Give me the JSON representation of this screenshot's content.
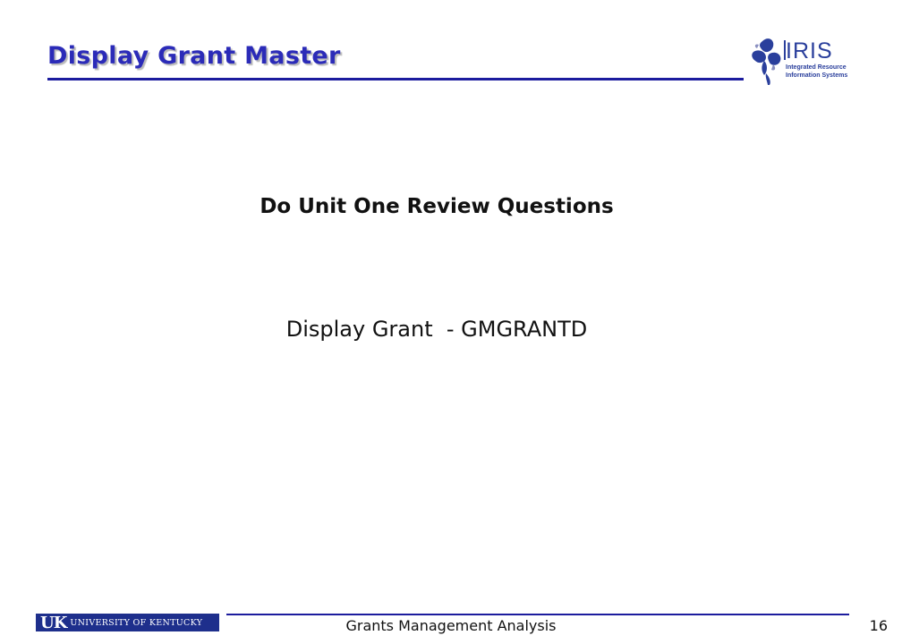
{
  "slide": {
    "title": "Display Grant Master",
    "review_heading": "Do Unit One Review Questions",
    "transaction_line": "Display Grant  - GMGRANTD"
  },
  "logo": {
    "icon": "iris-flower-icon",
    "mark": "IRIS",
    "subtitle_line1": "Integrated Resource",
    "subtitle_line2": "Information Systems",
    "color": "#2a3f9c"
  },
  "footer": {
    "uk_mark": "UK",
    "uk_name": "UNIVERSITY OF KENTUCKY",
    "text": "Grants Management Analysis",
    "page_number": "16"
  },
  "colors": {
    "title": "#2b2bb8",
    "rule": "#1c1c9e",
    "uk_brand": "#1e2f8c"
  }
}
